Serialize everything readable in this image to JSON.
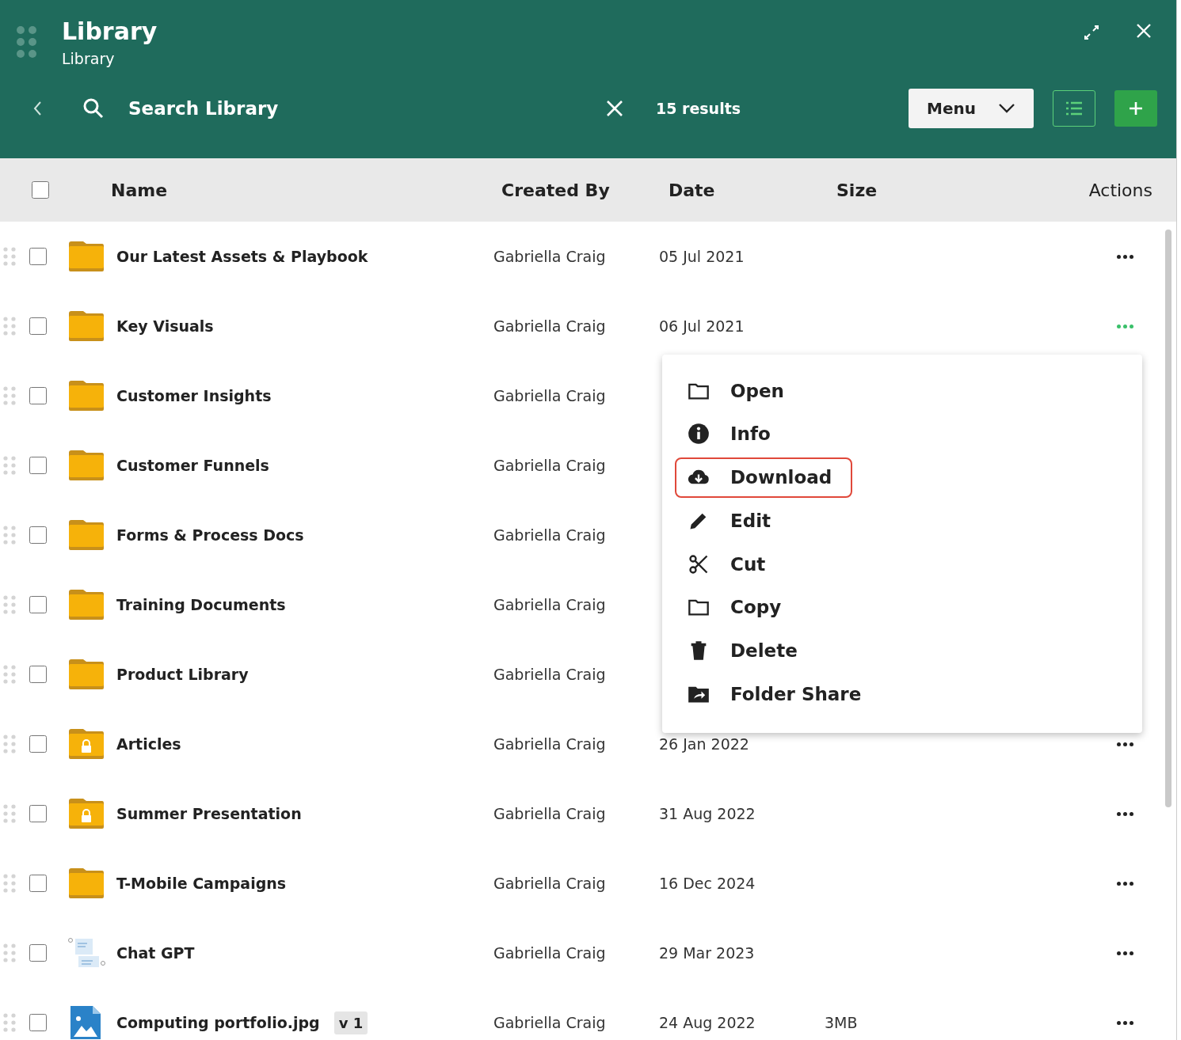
{
  "window": {
    "title": "Library",
    "subtitle": "Library"
  },
  "search": {
    "placeholder": "Search Library",
    "results": "15 results"
  },
  "toolbar": {
    "menu_label": "Menu"
  },
  "table": {
    "select_all_checked": false,
    "columns": [
      "Name",
      "Created By",
      "Date",
      "Size",
      "Actions"
    ],
    "rows": [
      {
        "kind": "folder",
        "name": "Our Latest Assets & Playbook",
        "created_by": "Gabriella Craig",
        "date": "05 Jul 2021",
        "checked": false,
        "menu_open": false
      },
      {
        "kind": "folder",
        "name": "Key Visuals",
        "created_by": "Gabriella Craig",
        "date": "06 Jul 2021",
        "checked": false,
        "menu_open": true
      },
      {
        "kind": "folder",
        "name": "Customer Insights",
        "created_by": "Gabriella Craig",
        "checked": false
      },
      {
        "kind": "folder",
        "name": "Customer Funnels",
        "created_by": "Gabriella Craig",
        "checked": false
      },
      {
        "kind": "folder",
        "name": "Forms & Process Docs",
        "created_by": "Gabriella Craig",
        "checked": false
      },
      {
        "kind": "folder",
        "name": "Training Documents",
        "created_by": "Gabriella Craig",
        "checked": false
      },
      {
        "kind": "folder",
        "name": "Product Library",
        "created_by": "Gabriella Craig",
        "checked": false
      },
      {
        "kind": "locked",
        "name": "Articles",
        "created_by": "Gabriella Craig",
        "date": "26 Jan 2022",
        "checked": false,
        "menu_open": false
      },
      {
        "kind": "locked",
        "name": "Summer Presentation",
        "created_by": "Gabriella Craig",
        "date": "31 Aug 2022",
        "checked": false,
        "menu_open": false
      },
      {
        "kind": "folder",
        "name": "T-Mobile Campaigns",
        "created_by": "Gabriella Craig",
        "date": "16 Dec 2024",
        "checked": false,
        "menu_open": false
      },
      {
        "kind": "chat",
        "name": "Chat GPT",
        "created_by": "Gabriella Craig",
        "date": "29 Mar 2023",
        "checked": false,
        "menu_open": false
      },
      {
        "kind": "image",
        "name": "Computing portfolio.jpg",
        "version": "v 1",
        "created_by": "Gabriella Craig",
        "date": "24 Aug 2022",
        "size": "3MB",
        "checked": false,
        "menu_open": false
      }
    ]
  },
  "context_menu": {
    "items": [
      {
        "kind": "open",
        "label": "Open",
        "highlighted": false
      },
      {
        "kind": "info",
        "label": "Info",
        "highlighted": false
      },
      {
        "kind": "download",
        "label": "Download",
        "highlighted": true
      },
      {
        "kind": "edit",
        "label": "Edit",
        "highlighted": false
      },
      {
        "kind": "cut",
        "label": "Cut",
        "highlighted": false
      },
      {
        "kind": "copy",
        "label": "Copy",
        "highlighted": false
      },
      {
        "kind": "delete",
        "label": "Delete",
        "highlighted": false
      },
      {
        "kind": "share",
        "label": "Folder Share",
        "highlighted": false
      }
    ]
  }
}
